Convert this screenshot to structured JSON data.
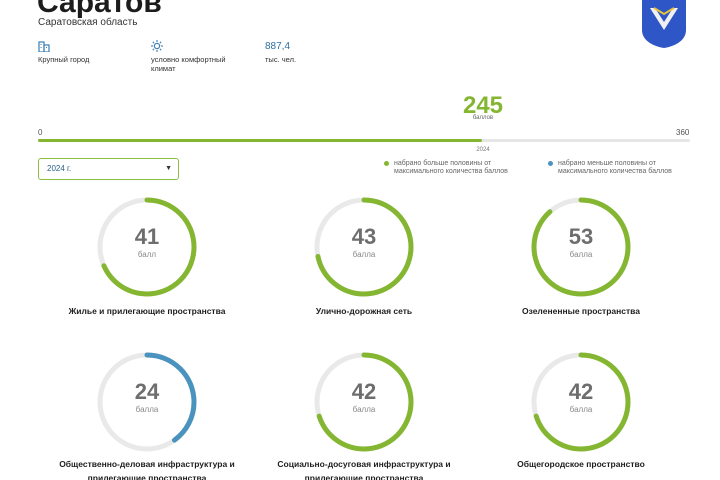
{
  "city": {
    "name": "Саратов",
    "region": "Саратовская область"
  },
  "facts": [
    {
      "icon": "buildings-icon",
      "label": "Крупный город"
    },
    {
      "icon": "sun-icon",
      "label": "условно комфортный климат"
    },
    {
      "value": "887,4",
      "label": "тыс. чел."
    }
  ],
  "total": {
    "value": "245",
    "unit": "баллов",
    "scale_min": "0",
    "scale_max": "360",
    "year_marker": "2024",
    "progress_value": 245
  },
  "year_select": {
    "value": "2024 г."
  },
  "legend": {
    "above_half": "набрано больше половины от максимального количества баллов",
    "below_half": "набрано меньше половины от максимального количества баллов"
  },
  "colors": {
    "above_half": "#84b632",
    "below_half": "#4a93be",
    "track": "#e9e9e9"
  },
  "categories": [
    {
      "score": "41",
      "unit": "балл",
      "name": "Жилье и прилегающие пространства",
      "value": 41,
      "max": 60,
      "status": "above_half"
    },
    {
      "score": "43",
      "unit": "балла",
      "name": "Улично-дорожная сеть",
      "value": 43,
      "max": 60,
      "status": "above_half"
    },
    {
      "score": "53",
      "unit": "балла",
      "name": "Озелененные пространства",
      "value": 53,
      "max": 60,
      "status": "above_half"
    },
    {
      "score": "24",
      "unit": "балла",
      "name": "Общественно-деловая инфраструктура и прилегающие пространства",
      "value": 24,
      "max": 60,
      "status": "below_half"
    },
    {
      "score": "42",
      "unit": "балла",
      "name": "Социально-досуговая инфраструктура и прилегающие пространства",
      "value": 42,
      "max": 60,
      "status": "above_half"
    },
    {
      "score": "42",
      "unit": "балла",
      "name": "Общегородское пространство",
      "value": 42,
      "max": 60,
      "status": "above_half"
    }
  ]
}
